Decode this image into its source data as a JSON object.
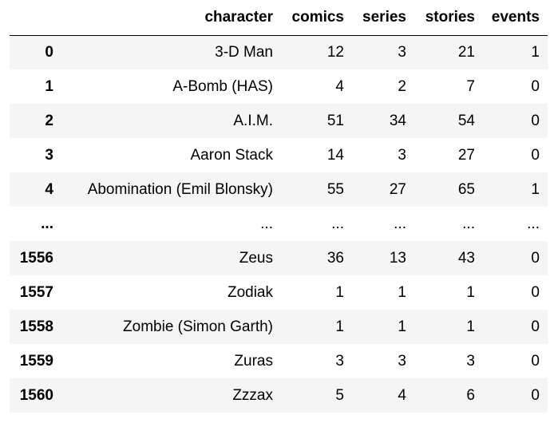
{
  "table": {
    "index_header": "",
    "columns": [
      "character",
      "comics",
      "series",
      "stories",
      "events"
    ],
    "rows": [
      {
        "index": "0",
        "cells": [
          "3-D Man",
          "12",
          "3",
          "21",
          "1"
        ]
      },
      {
        "index": "1",
        "cells": [
          "A-Bomb (HAS)",
          "4",
          "2",
          "7",
          "0"
        ]
      },
      {
        "index": "2",
        "cells": [
          "A.I.M.",
          "51",
          "34",
          "54",
          "0"
        ]
      },
      {
        "index": "3",
        "cells": [
          "Aaron Stack",
          "14",
          "3",
          "27",
          "0"
        ]
      },
      {
        "index": "4",
        "cells": [
          "Abomination (Emil Blonsky)",
          "55",
          "27",
          "65",
          "1"
        ]
      },
      {
        "index": "...",
        "cells": [
          "...",
          "...",
          "...",
          "...",
          "..."
        ]
      },
      {
        "index": "1556",
        "cells": [
          "Zeus",
          "36",
          "13",
          "43",
          "0"
        ]
      },
      {
        "index": "1557",
        "cells": [
          "Zodiak",
          "1",
          "1",
          "1",
          "0"
        ]
      },
      {
        "index": "1558",
        "cells": [
          "Zombie (Simon Garth)",
          "1",
          "1",
          "1",
          "0"
        ]
      },
      {
        "index": "1559",
        "cells": [
          "Zuras",
          "3",
          "3",
          "3",
          "0"
        ]
      },
      {
        "index": "1560",
        "cells": [
          "Zzzax",
          "5",
          "4",
          "6",
          "0"
        ]
      }
    ]
  }
}
